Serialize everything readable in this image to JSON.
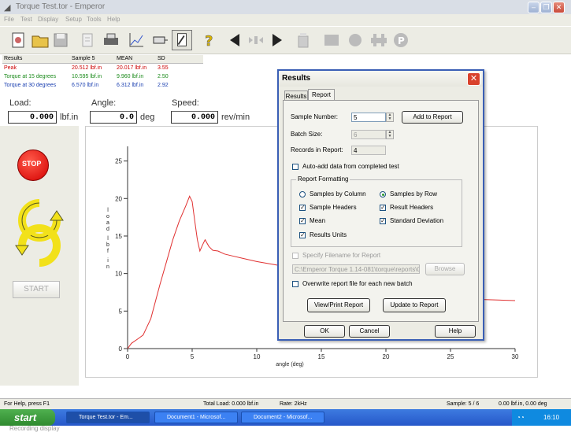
{
  "window": {
    "title": "Torque Test.tor - Emperor"
  },
  "menu": [
    "File",
    "Test",
    "Display",
    "Setup",
    "Tools",
    "Help"
  ],
  "toolbar": {
    "buttons": [
      "new-icon",
      "open-icon",
      "save-icon",
      "export-icon",
      "print-icon",
      "graph-icon",
      "reset-icon",
      "report-icon",
      "help-icon",
      "jog-left-icon",
      "stop-icon",
      "jog-right-icon",
      "clear-icon",
      "fixture-icon",
      "record-icon",
      "clamp-icon",
      "park-icon"
    ]
  },
  "results_table": {
    "headers": [
      "Results",
      "Sample 5",
      "MEAN",
      "SD"
    ],
    "rows": [
      {
        "name": "Peak",
        "sample": "20.512 lbf.in",
        "mean": "20.017 lbf.in",
        "sd": "3.55"
      },
      {
        "name": "Torque at 15 degrees",
        "sample": "10.595 lbf.in",
        "mean": "9.960 lbf.in",
        "sd": "2.50"
      },
      {
        "name": "Torque at 30 degrees",
        "sample": "6.570 lbf.in",
        "mean": "6.312 lbf.in",
        "sd": "2.92"
      }
    ],
    "row_colors": [
      "#cc0000",
      "#1a8a1a",
      "#1a3fb0"
    ]
  },
  "readouts": {
    "load": {
      "label": "Load:",
      "value": "0.000",
      "unit": "lbf.in"
    },
    "angle": {
      "label": "Angle:",
      "value": "0.0",
      "unit": "deg"
    },
    "speed": {
      "label": "Speed:",
      "value": "0.000",
      "unit": "rev/min"
    }
  },
  "controls": {
    "stop_label": "STOP",
    "start_label": "START"
  },
  "chart_data": {
    "type": "line",
    "xlabel": "angle (deg)",
    "ylabel": "load lbf in",
    "xlim": [
      0,
      30
    ],
    "ylim": [
      0,
      28
    ],
    "xticks": [
      "0",
      "5",
      "10",
      "15",
      "20",
      "25",
      "30"
    ],
    "yticks": [
      "0",
      "5",
      "10",
      "15",
      "20",
      "25"
    ],
    "series": [
      {
        "color": "#e03030",
        "x": [
          0,
          0.3,
          0.8,
          1.2,
          1.8,
          2.5,
          3.0,
          3.5,
          4.0,
          4.5,
          4.8,
          5.0,
          5.2,
          5.4,
          5.6,
          5.8,
          6.0,
          6.3,
          6.6,
          7.0,
          7.5,
          8.0,
          9.0,
          10.0,
          11.0,
          12.0,
          13.0,
          14.0,
          15.0
        ],
        "y": [
          0,
          0.7,
          1.3,
          1.8,
          4.0,
          8.5,
          11.5,
          14.5,
          17.0,
          19.0,
          20.3,
          19.6,
          17.0,
          14.5,
          13.0,
          13.8,
          14.5,
          13.6,
          13.1,
          13.0,
          12.6,
          12.4,
          12.0,
          11.6,
          11.3,
          11.0,
          10.9,
          10.7,
          10.6
        ]
      },
      {
        "color": "#e03030",
        "x": [
          26.5,
          30
        ],
        "y": [
          6.6,
          6.4
        ]
      }
    ]
  },
  "dialog": {
    "title": "Results",
    "tabs": [
      "Results",
      "Report"
    ],
    "sample_number_label": "Sample Number:",
    "sample_number": "5",
    "batch_size_label": "Batch Size:",
    "batch_size": "6",
    "records_label": "Records in Report:",
    "records": "4",
    "add_button": "Add to Report",
    "auto_add_label": "Auto-add data from completed test",
    "group_title": "Report Formatting",
    "by_column": "Samples by Column",
    "by_row": "Samples by Row",
    "sample_headers": "Sample Headers",
    "result_headers": "Result Headers",
    "mean": "Mean",
    "std_dev": "Standard Deviation",
    "results_units": "Results Units",
    "specify_filename": "Specify Filename for Report",
    "filename": "C:\\Emperor Torque 1.14-081\\torque\\reports\\06",
    "browse": "Browse",
    "overwrite": "Overwrite report file for each new batch",
    "view_print": "View/Print Report",
    "update": "Update to Report",
    "ok": "OK",
    "cancel": "Cancel",
    "help": "Help"
  },
  "statusbar": {
    "help": "For Help, press F1",
    "total_load": "Total Load: 0.000 lbf.in",
    "rate": "Rate: 2kHz",
    "sample": "Sample: 5 / 6",
    "position": "0.00 lbf.in, 0.00 deg"
  },
  "taskbar": {
    "start": "start",
    "tasks": [
      "Torque Test.tor - Em...",
      "Document1 - Microsof...",
      "Document2 - Microsof..."
    ],
    "clock": "16:10"
  },
  "caption": "Recording display"
}
